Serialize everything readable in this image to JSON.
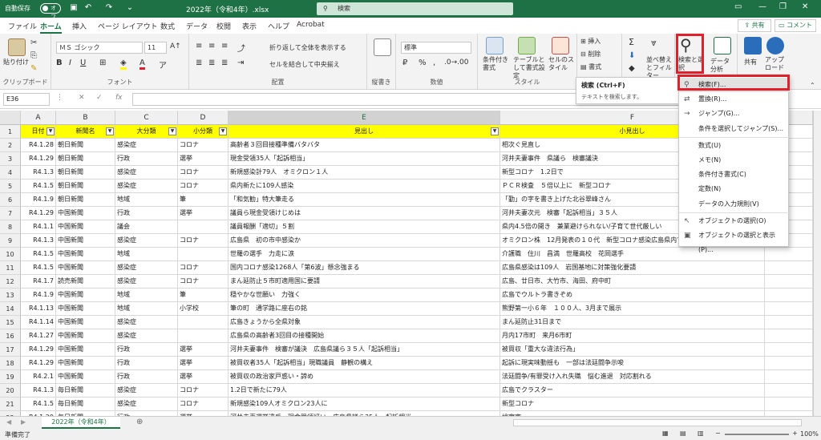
{
  "titlebar": {
    "autosave_label": "自動保存",
    "autosave_state": "オフ",
    "document_title": "2022年（令和4年）.xlsx",
    "search_placeholder": "検索"
  },
  "menu": {
    "tabs": [
      "ファイル",
      "ホーム",
      "挿入",
      "ページ レイアウト",
      "数式",
      "データ",
      "校閲",
      "表示",
      "ヘルプ",
      "Acrobat"
    ],
    "active_tab": "ホーム",
    "share_label": "共有",
    "comment_label": "コメント"
  },
  "ribbon": {
    "paste_label": "貼り付け",
    "clipboard_label": "クリップボード",
    "font_name": "ＭＳ ゴシック",
    "font_size": "11",
    "font_label": "フォント",
    "wrap_text": "折り返して全体を表示する",
    "merge_center": "セルを結合して中央揃え",
    "alignment_label": "配置",
    "vertical_label": "縦書き",
    "number_format": "標準",
    "number_label": "数値",
    "cond_format": "条件付き書式",
    "table_format": "テーブルとして書式設定",
    "cell_styles": "セルのスタイル",
    "styles_label": "スタイル",
    "insert": "挿入",
    "delete": "削除",
    "format": "書式",
    "cells_label": "セル",
    "sort_filter": "並べ替えとフィルター",
    "find_select": "検索と選択",
    "data_analysis": "データ分析",
    "share": "共有",
    "upload": "アップロード",
    "editing_label": "編集"
  },
  "formula_bar": {
    "name_box": "E36",
    "fx": "fx",
    "value": ""
  },
  "grid": {
    "columns": [
      "A",
      "B",
      "C",
      "D",
      "E",
      "F"
    ],
    "header": [
      "日付",
      "新聞名",
      "大分類",
      "小分類",
      "見出し",
      "小見出し"
    ],
    "rows": [
      [
        "R4.1.28",
        "朝日新聞",
        "感染症",
        "コロナ",
        "高齢者３回目接種準備バタバタ",
        "相次ぐ見直し"
      ],
      [
        "R4.1.29",
        "朝日新聞",
        "行政",
        "選挙",
        "現金受領35人「起訴相当」",
        "河井夫妻事件　県議ら　検審議決"
      ],
      [
        "R4.1.3",
        "朝日新聞",
        "感染症",
        "コロナ",
        "新規感染計79人　オミクロン１人",
        "新型コロナ　1.2日で"
      ],
      [
        "R4.1.5",
        "朝日新聞",
        "感染症",
        "コロナ",
        "県内新たに109人感染",
        "ＰＣＲ検査　５倍以上に　新型コロナ"
      ],
      [
        "R4.1.9",
        "朝日新聞",
        "地域",
        "筆",
        "「和気勧」特大筆走る",
        "「勤」の字を書き上げた北谷翠峰さん"
      ],
      [
        "R4.1.29",
        "中国新聞",
        "行政",
        "選挙",
        "議員ら現金受領けじめは",
        "河井夫妻次元　検審「起訴相当」３５人"
      ],
      [
        "R4.1.1",
        "中国新聞",
        "議会",
        "",
        "議員報酬「適切」５割",
        "県内4.5倍の開き　兼業避けられない/子育て世代厳しい"
      ],
      [
        "R4.1.3",
        "中国新聞",
        "感染症",
        "コロナ",
        "広島県　初の市中感染か",
        "オミクロン株　12月発表の１０代　新型コロナ感染広島県内で58人"
      ],
      [
        "R4.1.5",
        "中国新聞",
        "地域",
        "",
        "世羅の選手　力走に涙",
        "介護職　住川　昌満　世羅高校　花岡選手"
      ],
      [
        "R4.1.5",
        "中国新聞",
        "感染症",
        "コロナ",
        "国内コロナ感染1268人「第6波」懸念強まる",
        "広島県感染は109人　岩国基地に対策強化要請"
      ],
      [
        "R4.1.7",
        "読売新聞",
        "感染症",
        "コロナ",
        "まん延防止５市町適用国に要請",
        "広島、廿日市、大竹市、海田、府中町"
      ],
      [
        "R4.1.9",
        "中国新聞",
        "地域",
        "筆",
        "穏やかな世願い　力強く",
        "広島でウルトラ書きぞめ"
      ],
      [
        "R4.1.13",
        "中国新聞",
        "地域",
        "小学校",
        "筆の町　通学路に座右の銘",
        "熊野第一小６年　１００人、3月まで展示"
      ],
      [
        "R4.1.14",
        "中国新聞",
        "感染症",
        "",
        "広島きょうから全県対象",
        "まん延防止31日まで"
      ],
      [
        "R4.1.27",
        "中国新聞",
        "感染症",
        "",
        "広島県の高齢者3回目の接種開始",
        "月内17市町　来月6市町"
      ],
      [
        "R4.1.29",
        "中国新聞",
        "行政",
        "選挙",
        "河井夫妻事件　検審が議決　広島県議ら３５人「起訴相当」",
        "被買収「重大な違法行為」"
      ],
      [
        "R4.1.29",
        "中国新聞",
        "行政",
        "選挙",
        "被買収者35人「起訴相当」現職議員　静観の構え",
        "起訴に現実味動揺も　一部は法廷闘争示唆"
      ],
      [
        "R4.2.1",
        "中国新聞",
        "行政",
        "選挙",
        "被買収の政治家戸惑い・諦め",
        "法廷闘争/有罪受け入れ失職　悩む進退　対応割れる"
      ],
      [
        "R4.1.3",
        "毎日新聞",
        "感染症",
        "コロナ",
        "1.2日で新たに79人",
        "広島でクラスター"
      ],
      [
        "R4.1.5",
        "毎日新聞",
        "感染症",
        "コロナ",
        "新規感染109人オミクロン23人に",
        "新型コロナ"
      ],
      [
        "R4.1.29",
        "毎日新聞",
        "行政",
        "選挙",
        "河井夫妻選挙違反　現金受領疑い　広島県議ら35人　起訴相当",
        "検察審"
      ]
    ]
  },
  "sheet": {
    "tab_name": "2022年（令和4年）",
    "status": "準備完了",
    "zoom": "100%"
  },
  "tooltip": {
    "title": "検索 (Ctrl+F)",
    "desc": "テキストを検索します。"
  },
  "find_menu": {
    "items": [
      {
        "label": "検索(F)...",
        "icon": "search-icon"
      },
      {
        "label": "置換(R)...",
        "icon": "replace-icon"
      },
      {
        "label": "ジャンプ(G)...",
        "icon": "arrow-right-icon"
      },
      {
        "label": "条件を選択してジャンプ(S)...",
        "icon": ""
      },
      {
        "label": "数式(U)",
        "icon": ""
      },
      {
        "label": "メモ(N)",
        "icon": ""
      },
      {
        "label": "条件付き書式(C)",
        "icon": ""
      },
      {
        "label": "定数(N)",
        "icon": ""
      },
      {
        "label": "データの入力規則(V)",
        "icon": ""
      },
      {
        "label": "オブジェクトの選択(O)",
        "icon": "pointer-icon"
      },
      {
        "label": "オブジェクトの選択と表示(P)...",
        "icon": "selection-pane-icon"
      }
    ]
  },
  "colors": {
    "accent": "#1e7145",
    "header_fill": "#ffff00",
    "highlight": "#e0202a"
  }
}
